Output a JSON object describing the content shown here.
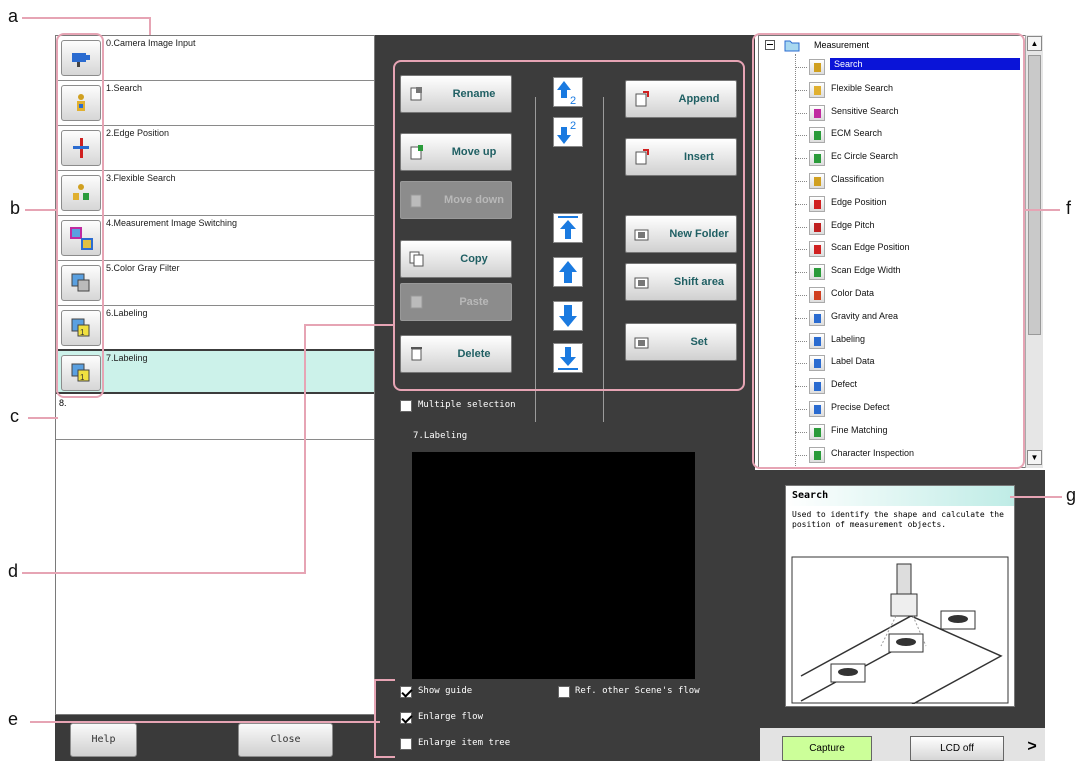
{
  "callouts": {
    "a": "a",
    "b": "b",
    "c": "c",
    "d": "d",
    "e": "e",
    "f": "f",
    "g": "g"
  },
  "flow": {
    "rows": [
      {
        "label": "0.Camera Image Input",
        "icon": "camera-icon"
      },
      {
        "label": "1.Search",
        "icon": "search-unit-icon"
      },
      {
        "label": "2.Edge Position",
        "icon": "edge-position-icon"
      },
      {
        "label": "3.Flexible Search",
        "icon": "flexible-search-icon"
      },
      {
        "label": "4.Measurement Image Switching",
        "icon": "image-switching-icon"
      },
      {
        "label": "5.Color Gray Filter",
        "icon": "color-gray-filter-icon"
      },
      {
        "label": "6.Labeling",
        "icon": "labeling-icon"
      },
      {
        "label": "7.Labeling",
        "icon": "labeling-icon"
      }
    ],
    "empty_row_label": "8.",
    "help_label": "Help",
    "close_label": "Close"
  },
  "edit": {
    "rename": "Rename",
    "move_up": "Move up",
    "move_down": "Move down",
    "copy": "Copy",
    "paste": "Paste",
    "delete": "Delete",
    "append": "Append",
    "insert": "Insert",
    "new_folder": "New Folder",
    "shift_area": "Shift area",
    "set": "Set"
  },
  "options": {
    "multiple_selection": "Multiple selection",
    "preview_title": "7.Labeling",
    "show_guide": "Show guide",
    "ref_other_scene": "Ref. other Scene's flow",
    "enlarge_flow": "Enlarge flow",
    "enlarge_item_tree": "Enlarge item tree",
    "show_guide_checked": true,
    "enlarge_flow_checked": true
  },
  "tree": {
    "root": "Measurement",
    "items": [
      "Search",
      "Flexible Search",
      "Sensitive Search",
      "ECM Search",
      "Ec Circle Search",
      "Classification",
      "Edge Position",
      "Edge Pitch",
      "Scan Edge Position",
      "Scan Edge Width",
      "Color Data",
      "Gravity and Area",
      "Labeling",
      "Label Data",
      "Defect",
      "Precise Defect",
      "Fine Matching",
      "Character Inspection"
    ],
    "selected": "Search"
  },
  "guide": {
    "title": "Search",
    "text": "Used to identify the shape and calculate the position of measurement objects."
  },
  "bottom": {
    "capture": "Capture",
    "lcd_off": "LCD off",
    "more": ">"
  },
  "colors": {
    "selection_blue": "#0a14d8",
    "selected_row": "#ccf2ea",
    "capture_green": "#ccff99",
    "callout_pink": "#e6a4b4"
  }
}
